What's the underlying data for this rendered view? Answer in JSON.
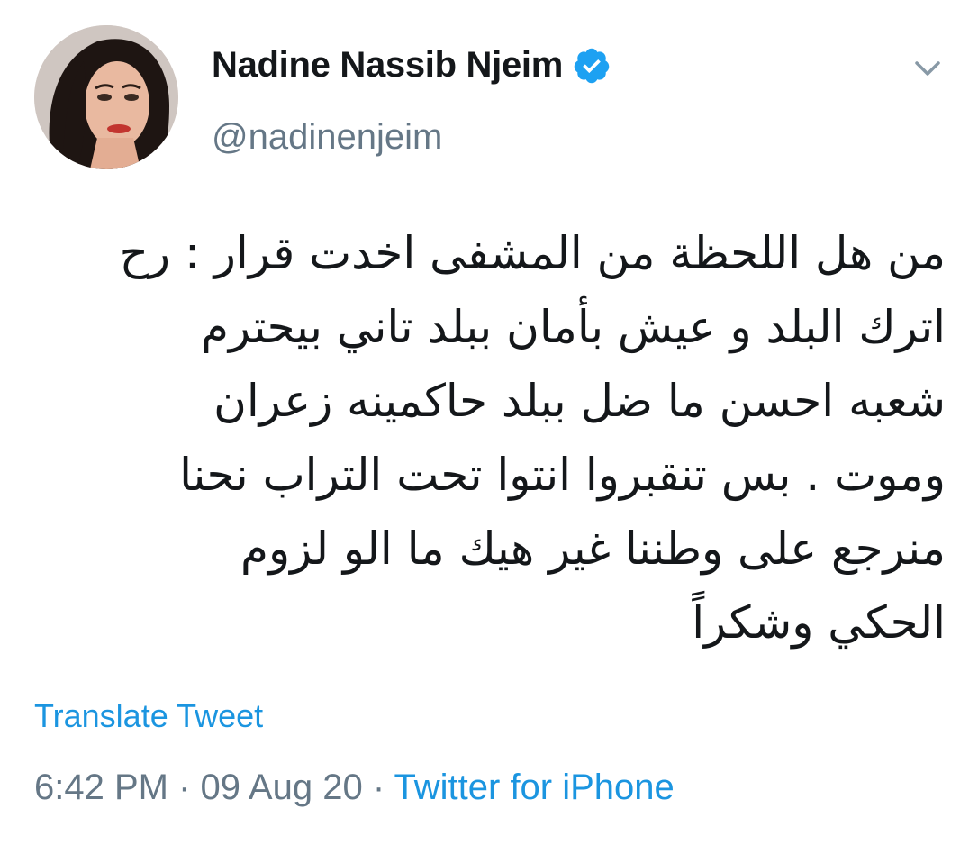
{
  "author": {
    "name": "Nadine Nassib Njeim",
    "handle": "@nadinenjeim",
    "verified": true
  },
  "tweet": {
    "lines": [
      "من هل اللحظة من المشفى اخدت قرار : رح",
      "اترك البلد و عيش بأمان ببلد تاني بيحترم",
      "شعبه احسن ما ضل ببلد حاكمينه زعران",
      "وموت . بس تنقبروا انتوا تحت التراب نحنا",
      "منرجع على وطننا غير هيك ما الو لزوم",
      "الحكي وشكراً"
    ]
  },
  "translate_label": "Translate Tweet",
  "meta": {
    "time": "6:42 PM",
    "separator_1": " · ",
    "date": "09 Aug 20",
    "separator_2": " · ",
    "source": "Twitter for iPhone"
  },
  "icons": {
    "verified": "verified-badge-icon",
    "menu": "chevron-down-icon"
  },
  "colors": {
    "accent": "#1b95e0",
    "verified": "#1da1f2",
    "secondary_text": "#657786",
    "primary_text": "#14171a"
  }
}
